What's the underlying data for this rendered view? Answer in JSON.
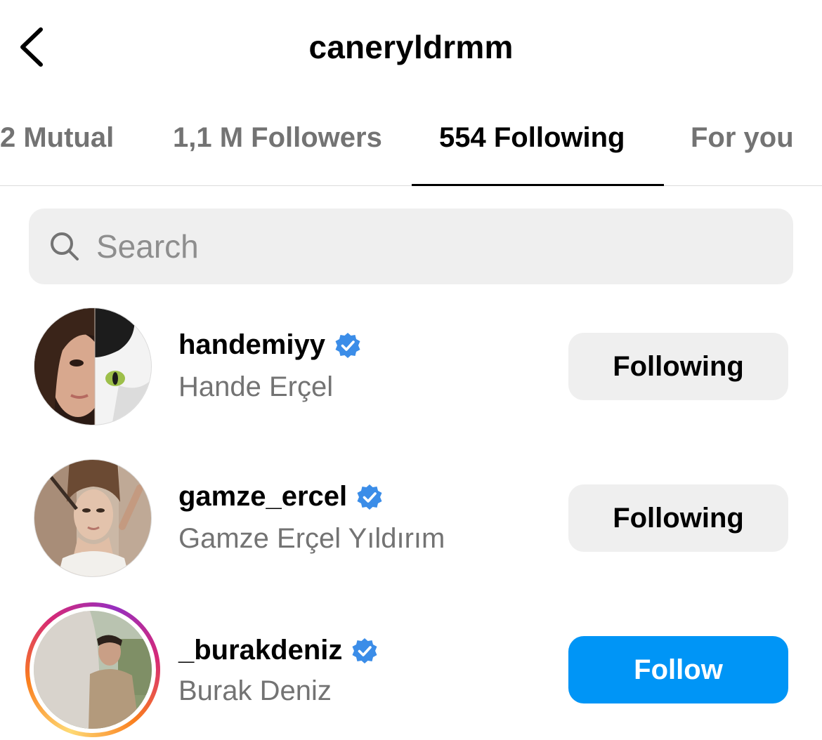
{
  "header": {
    "title": "caneryldrmm",
    "back_icon": "chevron-left-icon"
  },
  "tabs": [
    {
      "label": "2 Mutual",
      "active": false
    },
    {
      "label": "1,1 M Followers",
      "active": false
    },
    {
      "label": "554 Following",
      "active": true
    },
    {
      "label": "For you",
      "active": false
    }
  ],
  "search": {
    "placeholder": "Search",
    "value": "",
    "icon": "search-icon"
  },
  "list": [
    {
      "username": "handemiyy",
      "full_name": "Hande Erçel",
      "verified": true,
      "story_ring": false,
      "button_label": "Following",
      "button_state": "following"
    },
    {
      "username": "gamze_ercel",
      "full_name": "Gamze Erçel Yıldırım",
      "verified": true,
      "story_ring": false,
      "button_label": "Following",
      "button_state": "following"
    },
    {
      "username": "_burakdeniz",
      "full_name": "Burak Deniz",
      "verified": true,
      "story_ring": true,
      "button_label": "Follow",
      "button_state": "follow"
    }
  ],
  "colors": {
    "accent_blue": "#0095f6",
    "verified_blue": "#3b8de8",
    "secondary_text": "#737373",
    "button_gray": "#efefef",
    "divider": "#dbdbdb"
  }
}
